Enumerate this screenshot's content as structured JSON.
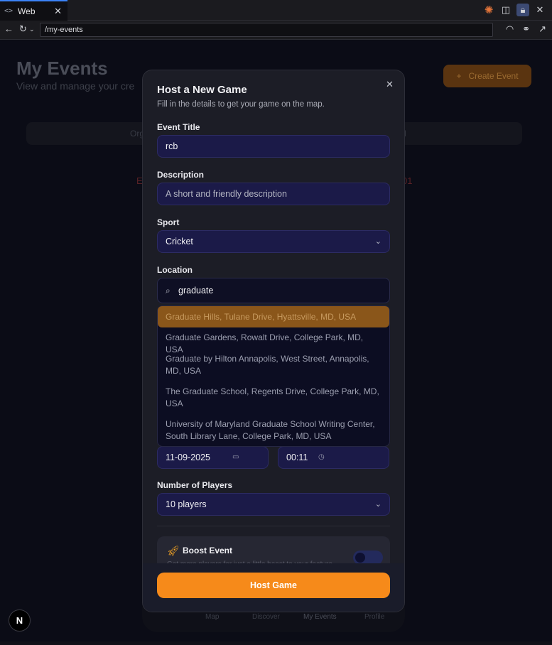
{
  "browser": {
    "tab_label": "Web",
    "tab_icon": "code-icon",
    "url": "/my-events"
  },
  "page": {
    "title": "My Events",
    "subtitle": "View and manage your cre",
    "create_button": "Create Event",
    "segment_left": "Org",
    "segment_right": "d",
    "error_left": "E",
    "error_right": "01",
    "bottom_nav": [
      "Map",
      "Discover",
      "My Events",
      "Profile"
    ],
    "next_badge": "N"
  },
  "modal": {
    "title": "Host a New Game",
    "subtitle": "Fill in the details to get your game on the map.",
    "close_icon": "close-icon",
    "event_title": {
      "label": "Event Title",
      "value": "rcb"
    },
    "description": {
      "label": "Description",
      "placeholder": "A short and friendly description"
    },
    "sport": {
      "label": "Sport",
      "value": "Cricket"
    },
    "location": {
      "label": "Location",
      "query": "graduate",
      "suggestions": [
        "Graduate Hills, Tulane Drive, Hyattsville, MD, USA",
        "Graduate Gardens, Rowalt Drive, College Park, MD, USA",
        "Graduate by Hilton Annapolis, West Street, Annapolis, MD, USA",
        "The Graduate School, Regents Drive, College Park, MD, USA",
        "University of Maryland Graduate School Writing Center, South Library Lane, College Park, MD, USA"
      ],
      "highlighted_index": 0
    },
    "date": {
      "value": "11-09-2025"
    },
    "time": {
      "value": "00:11"
    },
    "players": {
      "label": "Number of Players",
      "value": "10 players"
    },
    "boost": {
      "title": "Boost Event",
      "description": "Get more players for just a little boost to your feature"
    },
    "submit": "Host Game"
  },
  "colors": {
    "accent": "#f68a1a",
    "field_bg": "#1b1a48",
    "modal_bg": "#1c1d26"
  }
}
